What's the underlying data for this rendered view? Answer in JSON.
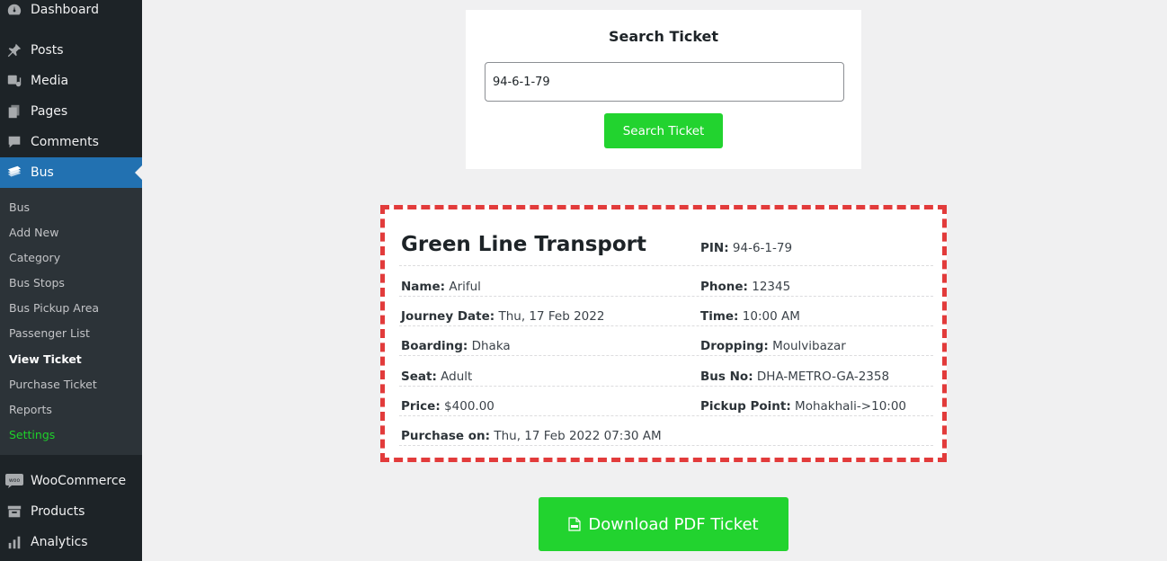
{
  "sidebar": {
    "menu": [
      {
        "label": "Dashboard",
        "icon": "dashboard-icon"
      },
      {
        "label": "Posts",
        "icon": "pin-icon"
      },
      {
        "label": "Media",
        "icon": "media-icon"
      },
      {
        "label": "Pages",
        "icon": "pages-icon"
      },
      {
        "label": "Comments",
        "icon": "comment-icon"
      },
      {
        "label": "Bus",
        "icon": "bus-icon"
      }
    ],
    "submenu": [
      "Bus",
      "Add New",
      "Category",
      "Bus Stops",
      "Bus Pickup Area",
      "Passenger List",
      "View Ticket",
      "Purchase Ticket",
      "Reports",
      "Settings"
    ],
    "lower_menu": [
      {
        "label": "WooCommerce",
        "icon": "woo-icon"
      },
      {
        "label": "Products",
        "icon": "archive-icon"
      },
      {
        "label": "Analytics",
        "icon": "chart-icon"
      }
    ]
  },
  "search": {
    "title": "Search Ticket",
    "input_value": "94-6-1-79",
    "button_label": "Search Ticket"
  },
  "ticket": {
    "company": "Green Line Transport",
    "pin_label": "PIN:",
    "pin": "94-6-1-79",
    "name_label": "Name:",
    "name": "Ariful",
    "phone_label": "Phone:",
    "phone": "12345",
    "journey_label": "Journey Date:",
    "journey_date": "Thu, 17 Feb 2022",
    "time_label": "Time:",
    "time": "10:00 AM",
    "boarding_label": "Boarding:",
    "boarding": "Dhaka",
    "dropping_label": "Dropping:",
    "dropping": "Moulvibazar",
    "seat_label": "Seat:",
    "seat": "Adult",
    "busno_label": "Bus No:",
    "bus_no": "DHA-METRO-GA-2358",
    "price_label": "Price:",
    "price": "$400.00",
    "pickup_label": "Pickup Point:",
    "pickup": "Mohakhali->10:00",
    "purchase_label": "Purchase on:",
    "purchase_on": "Thu, 17 Feb 2022 07:30 AM"
  },
  "download": {
    "label": "Download PDF Ticket"
  },
  "colors": {
    "accent_green": "#22d32f",
    "admin_blue": "#2271b1",
    "dash_red": "#e23b3b"
  }
}
